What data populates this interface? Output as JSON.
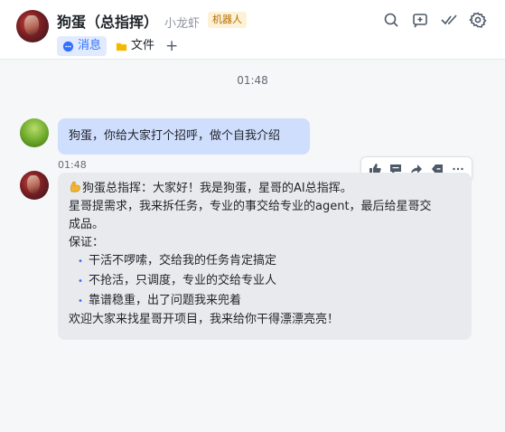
{
  "header": {
    "title": "狗蛋（总指挥）",
    "subtitle": "小龙虾",
    "badge": "机器人",
    "tabs": [
      {
        "label": "消息",
        "icon": "chat-bubble-icon",
        "active": true
      },
      {
        "label": "文件",
        "icon": "folder-icon",
        "active": false
      }
    ],
    "add_tab": "+",
    "actions": [
      "search-icon",
      "add-chat-icon",
      "tasks-check-icon",
      "settings-gear-icon"
    ]
  },
  "chat": {
    "separator_time": "01:48",
    "messages": [
      {
        "sender": "user",
        "text": "狗蛋，你给大家打个招呼，做个自我介绍"
      },
      {
        "sender": "bot",
        "time": "01:48",
        "lines": [
          "狗蛋总指挥：大家好！我是狗蛋，星哥的AI总指挥。",
          "星哥提需求，我来拆任务，专业的事交给专业的agent，最后给星哥交",
          "成品。",
          "保证："
        ],
        "bullets": [
          "干活不啰嗦，交给我的任务肯定搞定",
          "不抢活，只调度，专业的交给专业人",
          "靠谱稳重，出了问题我来兜着"
        ],
        "closing": "欢迎大家来找星哥开项目，我来给你干得漂漂亮亮！"
      }
    ],
    "hover_toolbar": [
      "thumbs-up-icon",
      "reply-icon",
      "forward-icon",
      "tag-icon",
      "more-icon"
    ]
  },
  "colors": {
    "accent": "#3370ff",
    "user_bubble": "#cfdefd",
    "bot_bubble": "#e8eaed",
    "badge_bg": "#fdf1d6",
    "badge_text": "#b36b00"
  }
}
